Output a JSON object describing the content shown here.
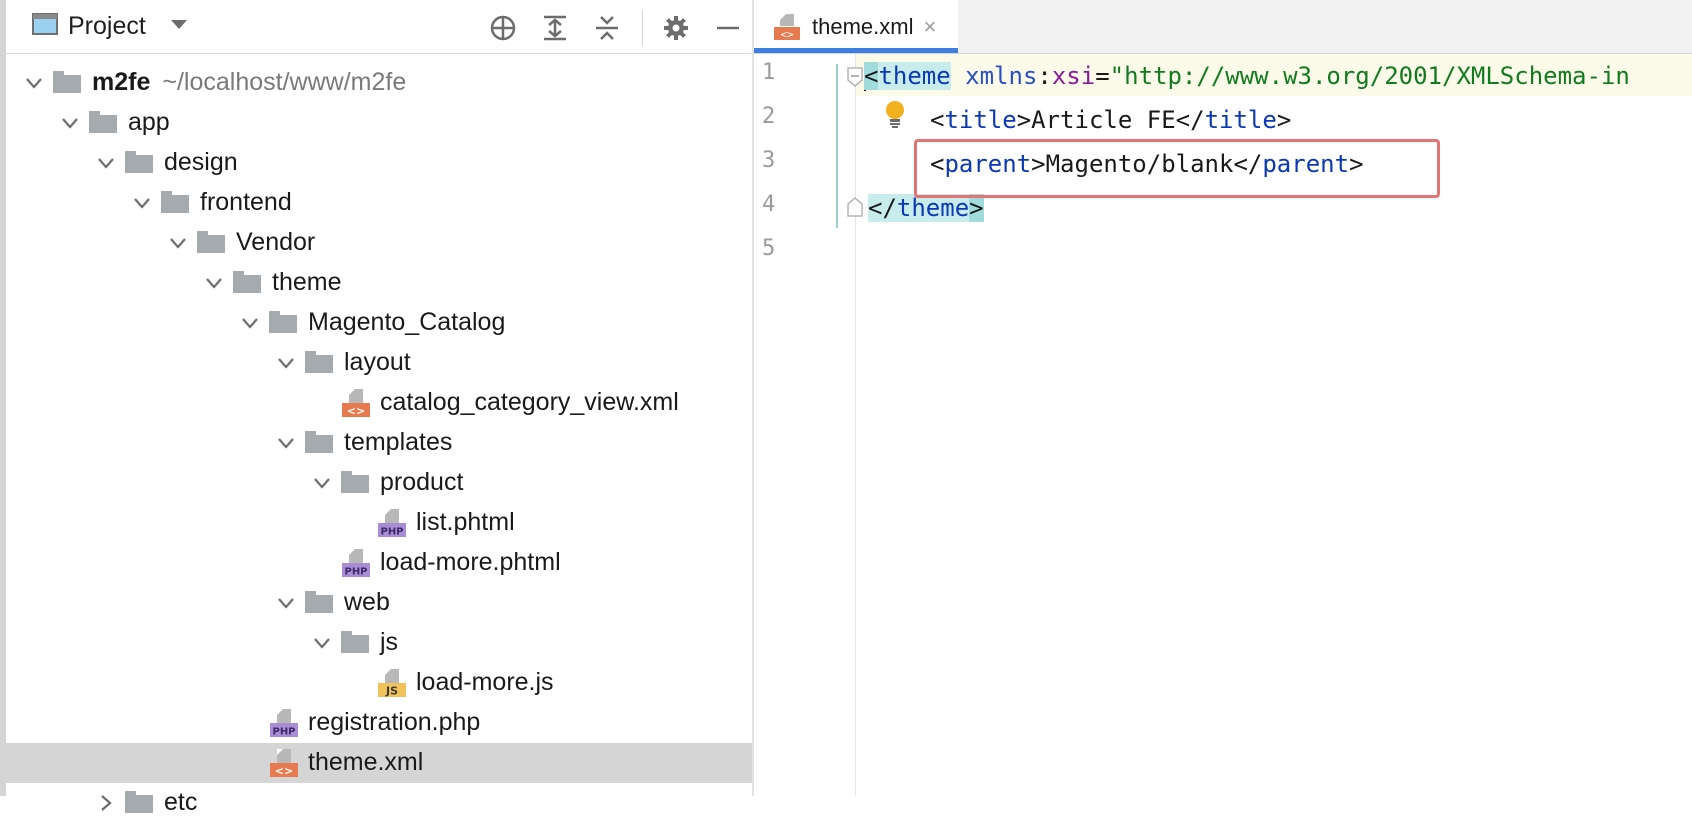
{
  "project_panel": {
    "title": "Project",
    "tools": [
      "locate-icon",
      "expand-all-icon",
      "collapse-all-icon",
      "gear-icon",
      "minimize-icon"
    ],
    "tree": [
      {
        "name": "m2fe",
        "path": "~/localhost/www/m2fe",
        "type": "folder",
        "depth": 0,
        "expanded": true,
        "bold": true
      },
      {
        "name": "app",
        "type": "folder",
        "depth": 1,
        "expanded": true
      },
      {
        "name": "design",
        "type": "folder",
        "depth": 2,
        "expanded": true
      },
      {
        "name": "frontend",
        "type": "folder",
        "depth": 3,
        "expanded": true
      },
      {
        "name": "Vendor",
        "type": "folder",
        "depth": 4,
        "expanded": true
      },
      {
        "name": "theme",
        "type": "folder",
        "depth": 5,
        "expanded": true
      },
      {
        "name": "Magento_Catalog",
        "type": "folder",
        "depth": 6,
        "expanded": true
      },
      {
        "name": "layout",
        "type": "folder",
        "depth": 7,
        "expanded": true
      },
      {
        "name": "catalog_category_view.xml",
        "type": "xml",
        "depth": 8
      },
      {
        "name": "templates",
        "type": "folder",
        "depth": 7,
        "expanded": true
      },
      {
        "name": "product",
        "type": "folder",
        "depth": 8,
        "expanded": true
      },
      {
        "name": "list.phtml",
        "type": "php",
        "depth": 9
      },
      {
        "name": "load-more.phtml",
        "type": "php",
        "depth": 8
      },
      {
        "name": "web",
        "type": "folder",
        "depth": 7,
        "expanded": true
      },
      {
        "name": "js",
        "type": "folder",
        "depth": 8,
        "expanded": true
      },
      {
        "name": "load-more.js",
        "type": "js",
        "depth": 9
      },
      {
        "name": "registration.php",
        "type": "php",
        "depth": 6
      },
      {
        "name": "theme.xml",
        "type": "xml",
        "depth": 6,
        "selected": true
      },
      {
        "name": "etc",
        "type": "folder",
        "depth": 2,
        "expanded": false
      }
    ]
  },
  "editor": {
    "tab": {
      "label": "theme.xml",
      "close": "×",
      "icon": "xml-file-icon"
    },
    "line_numbers": [
      "1",
      "2",
      "3",
      "4",
      "5"
    ],
    "code": {
      "line1": {
        "open": "<",
        "tag": "theme",
        "attr_ns": "xmlns",
        "colon": ":",
        "attr_name": "xsi",
        "eq": "=",
        "value": "\"http://www.w3.org/2001/XMLSchema-in"
      },
      "line2": {
        "open": "<",
        "tag": "title",
        "close_open": ">",
        "text": "Article FE",
        "end_open": "</",
        "end_tag": "title",
        "end_close": ">"
      },
      "line3": {
        "open": "<",
        "tag": "parent",
        "close_open": ">",
        "text": "Magento/blank",
        "end_open": "</",
        "end_tag": "parent",
        "end_close": ">"
      },
      "line4": {
        "end_open": "</",
        "end_tag": "theme",
        "end_close": ">"
      }
    },
    "highlight_color": "#e27474",
    "accent": "#3d7ede"
  }
}
